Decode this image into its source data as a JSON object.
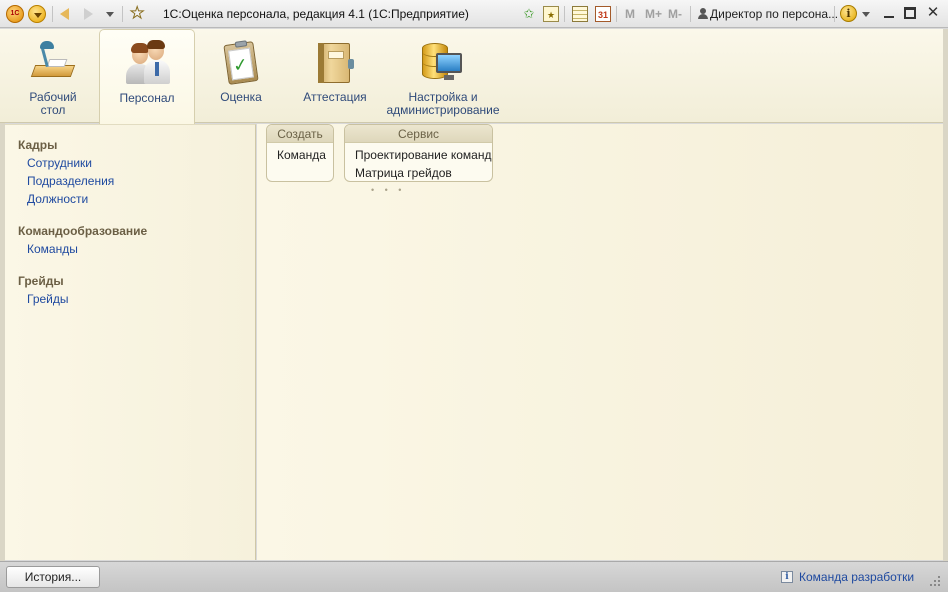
{
  "titlebar": {
    "logo_text": "1С",
    "title": "1С:Оценка персонала, редакция 4.1  (1С:Предприятие)",
    "calendar_day": "31",
    "mem_buttons": [
      "M",
      "M+",
      "M-"
    ],
    "user": "Директор по персона...",
    "info_glyph": "i"
  },
  "sections": [
    {
      "label": "Рабочий\nстол",
      "icon": "desktop-lamp-icon"
    },
    {
      "label": "Персонал",
      "icon": "people-icon",
      "active": true
    },
    {
      "label": "Оценка",
      "icon": "clipboard-check-icon"
    },
    {
      "label": "Аттестация",
      "icon": "folder-icon"
    },
    {
      "label": "Настройка и\nадминистрирование",
      "icon": "database-monitor-icon"
    }
  ],
  "left_nav": {
    "groups": [
      {
        "title": "Кадры",
        "items": [
          "Сотрудники",
          "Подразделения",
          "Должности"
        ]
      },
      {
        "title": "Командообразование",
        "items": [
          "Команды"
        ]
      },
      {
        "title": "Грейды",
        "items": [
          "Грейды"
        ]
      }
    ]
  },
  "panels": {
    "create": {
      "title": "Создать",
      "items": [
        "Команда"
      ]
    },
    "service": {
      "title": "Сервис",
      "items": [
        "Проектирование команд",
        "Матрица грейдов"
      ]
    }
  },
  "statusbar": {
    "history_label": "История...",
    "info_glyph": "i",
    "dev_link": "Команда разработки"
  },
  "colors": {
    "link": "#1f4aa0",
    "panel_bg": "#fbf7e6",
    "group_title": "#6b5f45"
  }
}
